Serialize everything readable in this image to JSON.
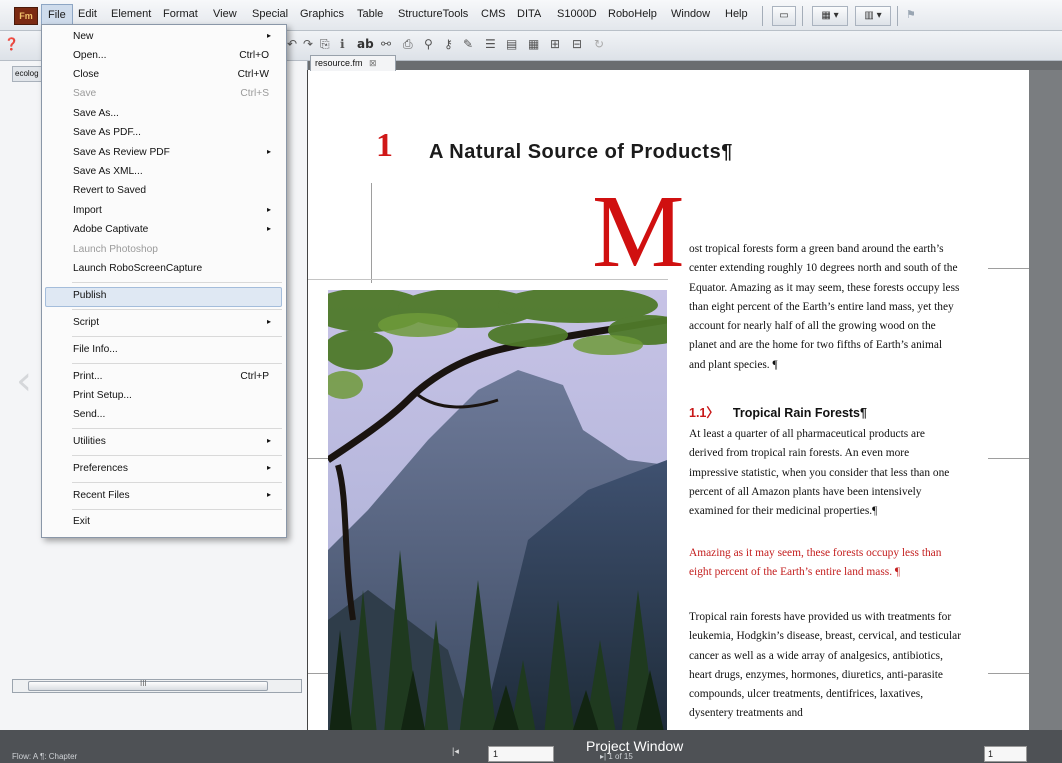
{
  "menubar": {
    "logo": "Fm",
    "items": [
      "File",
      "Edit",
      "Element",
      "Format",
      "View",
      "Special",
      "Graphics",
      "Table",
      "StructureTools",
      "CMS",
      "DITA",
      "S1000D",
      "RoboHelp",
      "Window",
      "Help"
    ]
  },
  "file_menu": {
    "items": [
      {
        "label": "New",
        "arrow": "▸"
      },
      {
        "label": "Open...",
        "shortcut": "Ctrl+O"
      },
      {
        "label": "Close",
        "shortcut": "Ctrl+W"
      },
      {
        "label": "Save",
        "shortcut": "Ctrl+S"
      },
      {
        "label": "Save As..."
      },
      {
        "label": "Save As PDF..."
      },
      {
        "label": "Save As Review PDF",
        "arrow": "▸"
      },
      {
        "label": "Save As XML..."
      },
      {
        "label": "Revert to Saved"
      },
      {
        "label": "Import",
        "arrow": "▸"
      },
      {
        "label": "Adobe Captivate",
        "arrow": "▸"
      },
      {
        "label": "Launch Photoshop"
      },
      {
        "label": "Launch RoboScreenCapture"
      },
      {
        "label": "Publish"
      },
      {
        "label": "Script",
        "arrow": "▸"
      },
      {
        "label": "File Info..."
      },
      {
        "label": "Print...",
        "shortcut": "Ctrl+P"
      },
      {
        "label": "Print Setup..."
      },
      {
        "label": "Send..."
      },
      {
        "label": "Utilities",
        "arrow": "▸"
      },
      {
        "label": "Preferences",
        "arrow": "▸"
      },
      {
        "label": "Recent Files",
        "arrow": "▸"
      },
      {
        "label": "Exit"
      }
    ]
  },
  "left_panel": {
    "tab_label": "ecolog",
    "scroll_grip": "III"
  },
  "document": {
    "tab_label": "resource.fm",
    "tab_close": "⊠",
    "chapter_number": "1",
    "chapter_title": "A Natural Source of Products¶",
    "drop_cap": "M",
    "paragraph1": "ost tropical forests form a green band around the earth’s center extending roughly 10 degrees north and south of the Equator. Amazing as it may seem, these forests occupy less than eight percent of the Earth’s entire land mass, yet they account for nearly half of all the growing wood on the planet and are the home for two fifths of Earth’s animal and plant species. ¶",
    "heading_number": "1.1〉",
    "heading_text": "Tropical Rain Forests¶",
    "paragraph2": "At least a quarter of all pharmaceutical products are derived from tropical rain forests. An even more impressive statistic, when you consider that less than one percent of all Amazon plants have been intensively examined for their medicinal properties.¶",
    "paragraph3": "Amazing as it may seem, these forests occupy less than eight percent of the Earth’s entire land mass. ¶",
    "paragraph4": "Tropical rain forests have provided us with treatments for leukemia, Hodgkin’s disease, breast, cervical, and testicular cancer as well as a wide array of analgesics, antibiotics, heart drugs, enzymes, hormones, diuretics, anti-parasite compounds, ulcer treatments, dentifrices, laxatives, dysentery treatments and"
  },
  "statusbar": {
    "flow": "Flow: A  ¶: Chapter",
    "overlay": "Project Window",
    "nav_first": "|◂",
    "page_number": "1",
    "page_of": "▸|  1 of 15",
    "zoom": "1"
  },
  "colors": {
    "accent_red": "#d01818",
    "menu_highlight": "#dfe8f3"
  }
}
